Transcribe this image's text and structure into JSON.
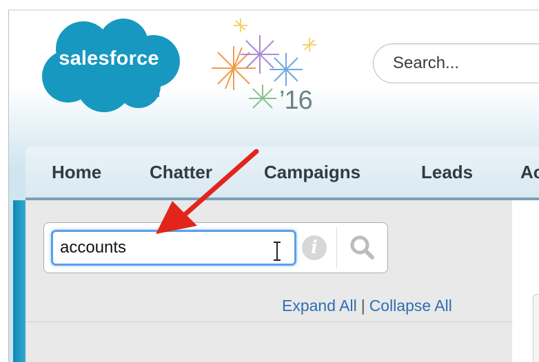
{
  "brand": {
    "logo_text": "salesforce",
    "release_year": "’16",
    "cloud_color": "#1798c1"
  },
  "header": {
    "search_placeholder": "Search..."
  },
  "nav": {
    "tabs": [
      {
        "label": "Home"
      },
      {
        "label": "Chatter"
      },
      {
        "label": "Campaigns"
      },
      {
        "label": "Leads"
      },
      {
        "label": "Ac"
      }
    ]
  },
  "sidebar": {
    "search_value": "accounts",
    "info_glyph": "i",
    "expand_all": "Expand All",
    "separator": "|",
    "collapse_all": "Collapse All"
  },
  "icons": {
    "info": "info-icon",
    "search": "search-icon",
    "text_cursor": "text-cursor-icon",
    "annotation": "red-arrow-annotation"
  },
  "colors": {
    "focus_border": "#5aa0e8",
    "link": "#2b6fb3",
    "arrow": "#e3241b",
    "accent": "#0c88b4"
  }
}
